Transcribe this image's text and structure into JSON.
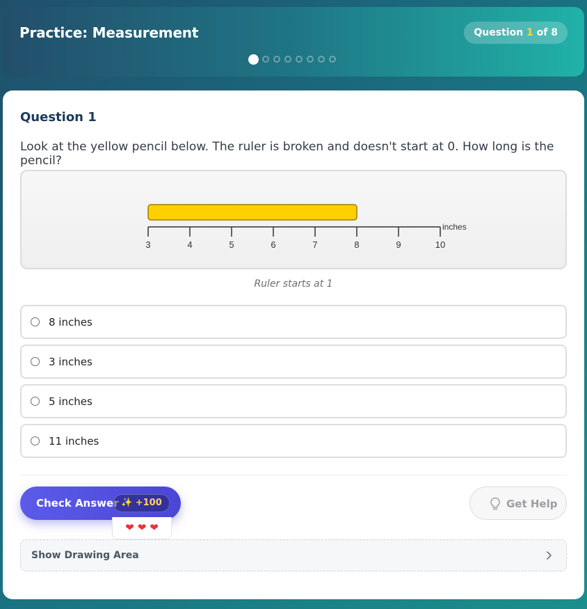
{
  "header": {
    "title": "Practice: Measurement",
    "progress_prefix": "Question ",
    "progress_current": "1",
    "progress_suffix": " of 8",
    "total_steps": 8,
    "current_step": 1
  },
  "question": {
    "title": "Question 1",
    "text": "Look at the yellow pencil below. The ruler is broken and doesn't start at 0. How long is the pencil?",
    "figure": {
      "ruler_ticks": [
        "3",
        "4",
        "5",
        "6",
        "7",
        "8",
        "9",
        "10"
      ],
      "ruler_unit": "inches",
      "pencil_start": 3,
      "pencil_end": 8,
      "pencil_color": "#ffd000"
    },
    "caption": "Ruler starts at 1"
  },
  "options": [
    {
      "label": "8 inches"
    },
    {
      "label": "3 inches"
    },
    {
      "label": "5 inches"
    },
    {
      "label": "11 inches"
    }
  ],
  "actions": {
    "check_label": "Check Answer",
    "xp_label": "+100",
    "xp_icon": "sparkles-icon",
    "lives": 3,
    "help_label": "Get Help",
    "drawing_label": "Show Drawing Area"
  },
  "colors": {
    "accent": "#4f4de0",
    "progress_highlight": "#ffd43b",
    "heart": "#e5343b"
  }
}
